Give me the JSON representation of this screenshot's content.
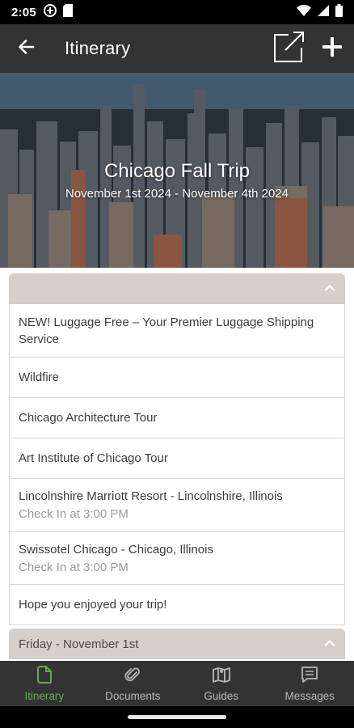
{
  "status_bar": {
    "time": "2:05",
    "left_icons": [
      "signal-app-icon",
      "sim-card-icon"
    ],
    "right_icons": [
      "wifi-icon",
      "cell-signal-icon",
      "battery-icon"
    ]
  },
  "app_bar": {
    "title": "Itinerary",
    "icons": {
      "back": "arrow-left-icon",
      "share": "open-external-icon",
      "add": "plus-icon"
    }
  },
  "trip": {
    "title": "Chicago Fall Trip",
    "dates": "November 1st 2024 - November 4th 2024"
  },
  "overview_section": {
    "header_label": "",
    "items": [
      {
        "title": "NEW! Luggage Free – Your Premier Luggage Shipping Service",
        "subtitle": ""
      },
      {
        "title": "Wildfire",
        "subtitle": ""
      },
      {
        "title": "Chicago Architecture Tour",
        "subtitle": ""
      },
      {
        "title": "Art Institute of Chicago Tour",
        "subtitle": ""
      },
      {
        "title": "Lincolnshire Marriott Resort - Lincolnshire, Illinois",
        "subtitle": "Check In at 3:00 PM"
      },
      {
        "title": "Swissotel Chicago - Chicago, Illinois",
        "subtitle": "Check In at 3:00 PM"
      },
      {
        "title": "Hope you enjoyed your trip!",
        "subtitle": ""
      }
    ]
  },
  "day_section": {
    "header_label": "Friday - November 1st"
  },
  "bottom_nav": [
    {
      "label": "Itinerary",
      "icon": "document-icon",
      "active": true
    },
    {
      "label": "Documents",
      "icon": "paperclip-icon",
      "active": false
    },
    {
      "label": "Guides",
      "icon": "map-book-icon",
      "active": false
    },
    {
      "label": "Messages",
      "icon": "message-icon",
      "active": false
    }
  ],
  "colors": {
    "bar_background": "#333333",
    "accent_green": "#5fae4c",
    "section_header": "#d6cfca",
    "divider": "#d6d6d6",
    "subtitle_gray": "#9a9a9a"
  }
}
